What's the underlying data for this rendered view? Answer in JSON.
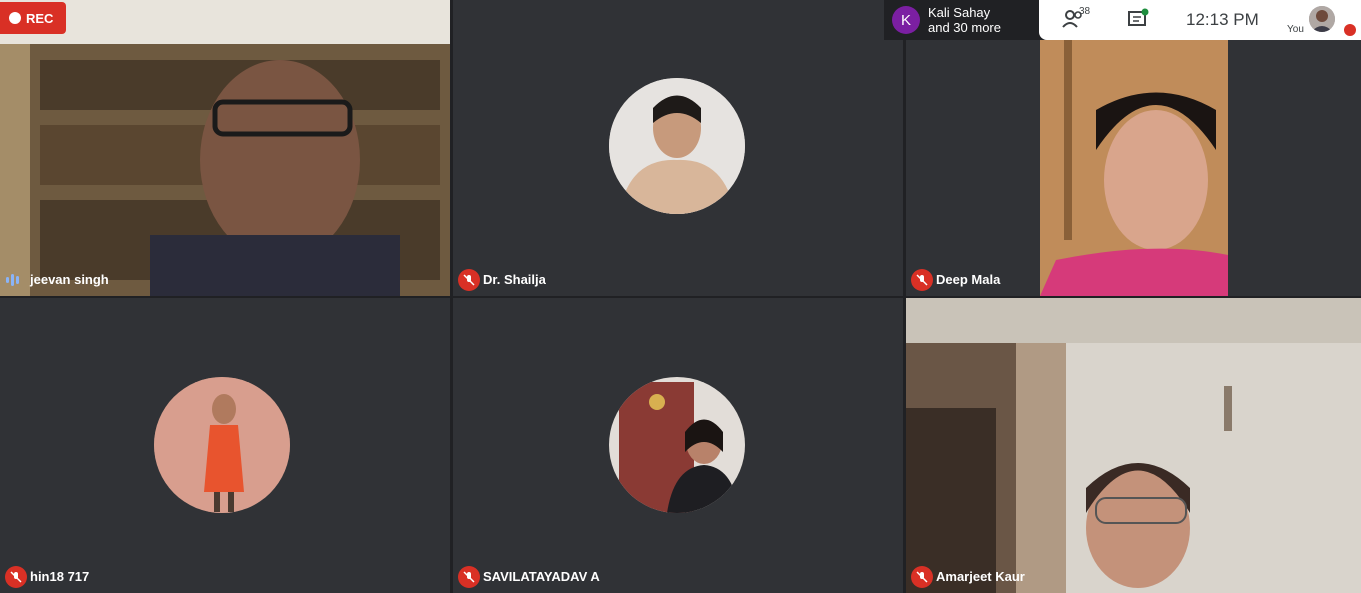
{
  "recording": {
    "label": "REC"
  },
  "participants_bar": {
    "avatar_letter": "K",
    "line1": "Kali Sahay",
    "line2": "and 30 more"
  },
  "toolbar": {
    "people_count": "38",
    "time": "12:13  PM",
    "self_label": "You"
  },
  "tiles": [
    {
      "name": "jeevan singh",
      "status": "speaking"
    },
    {
      "name": "Dr. Shailja",
      "status": "muted"
    },
    {
      "name": "Deep Mala",
      "status": "muted"
    },
    {
      "name": "hin18 717",
      "status": "muted"
    },
    {
      "name": "SAVILATAYADAV A",
      "status": "muted"
    },
    {
      "name": "Amarjeet Kaur",
      "status": "muted"
    }
  ],
  "colors": {
    "mute_red": "#d93025",
    "tile_bg": "#3c4043",
    "page_bg": "#202124",
    "speak_blue": "#8ab4f8"
  }
}
